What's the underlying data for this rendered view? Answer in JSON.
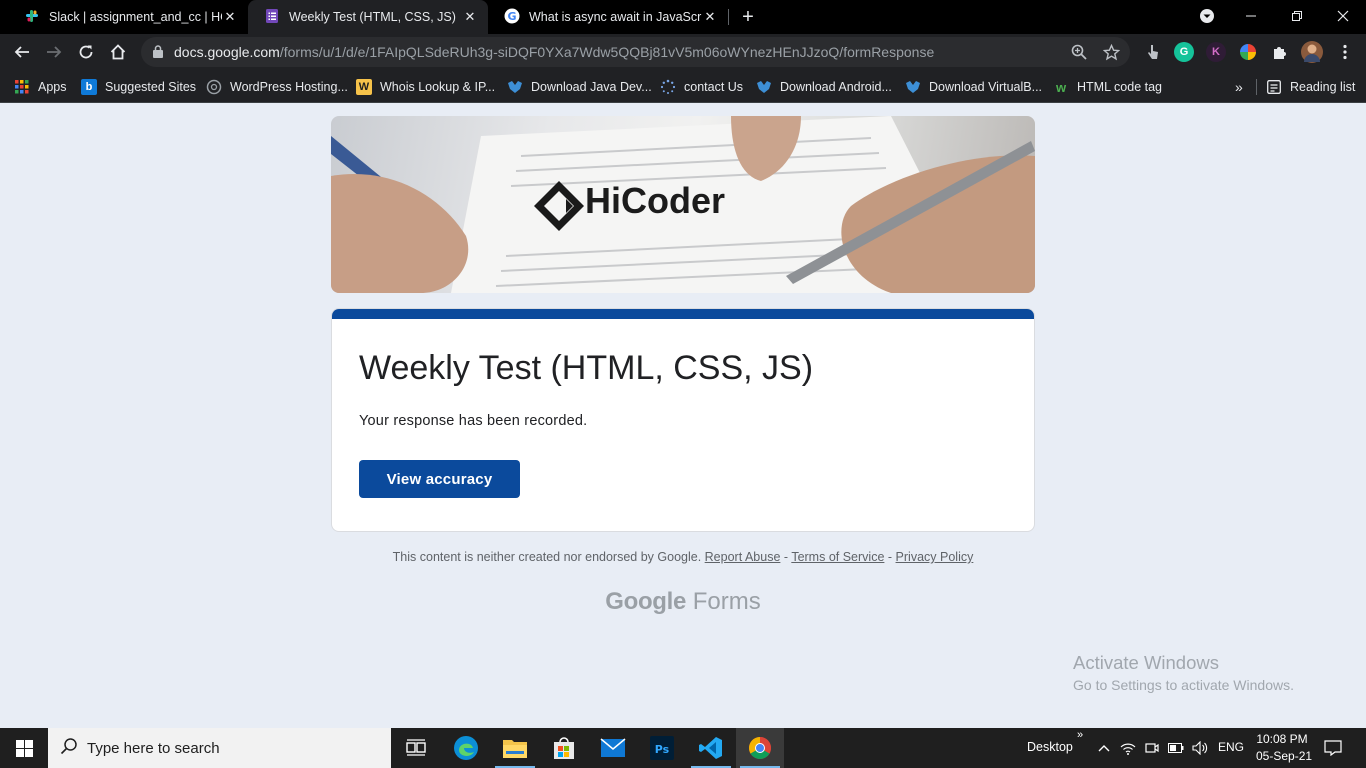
{
  "tabs": [
    {
      "title": "Slack | assignment_and_cc | HCM",
      "icon": "slack-icon"
    },
    {
      "title": "Weekly Test (HTML, CSS, JS)",
      "icon": "google-forms-icon",
      "active": true
    },
    {
      "title": "What is async await in JavaScript",
      "icon": "google-icon"
    }
  ],
  "address_bar": {
    "host": "docs.google.com",
    "path": "/forms/u/1/d/e/1FAIpQLSdeRUh3g-siDQF0YXa7Wdw5QQBj81vV5m06oWYnezHEnJJzoQ/formResponse"
  },
  "bookmarks": {
    "items": [
      {
        "label": "Apps",
        "icon": "apps-grid-icon"
      },
      {
        "label": "Suggested Sites",
        "icon": "bing-icon"
      },
      {
        "label": "WordPress Hosting...",
        "icon": "wordpress-hosting-icon"
      },
      {
        "label": "Whois Lookup & IP...",
        "icon": "whois-icon"
      },
      {
        "label": "Download Java Dev...",
        "icon": "filehorse-icon"
      },
      {
        "label": "contact Us",
        "icon": "loading-dots-icon"
      },
      {
        "label": "Download Android...",
        "icon": "filehorse-icon"
      },
      {
        "label": "Download VirtualB...",
        "icon": "filehorse-icon"
      },
      {
        "label": "HTML code tag",
        "icon": "w3-icon"
      }
    ],
    "overflow": "»",
    "reading_list": "Reading list"
  },
  "banner": {
    "brand": "HiCoder"
  },
  "form": {
    "title": "Weekly Test (HTML, CSS, JS)",
    "message": "Your response has been recorded.",
    "button": "View accuracy",
    "accent_color": "#0b4a9c"
  },
  "footer": {
    "disclaimer": "This content is neither created nor endorsed by Google.",
    "report_abuse": "Report Abuse",
    "sep": "-",
    "terms": "Terms of Service",
    "privacy": "Privacy Policy",
    "logo_google": "Google",
    "logo_forms": "Forms"
  },
  "watermark": {
    "line1": "Activate Windows",
    "line2": "Go to Settings to activate Windows."
  },
  "taskbar": {
    "search_placeholder": "Type here to search",
    "apps": [
      "task-view-icon",
      "edge-icon",
      "file-explorer-icon",
      "store-icon",
      "mail-icon",
      "photoshop-icon",
      "vscode-icon",
      "chrome-icon"
    ],
    "desktop_label": "Desktop",
    "language": "ENG",
    "time": "10:08 PM",
    "date": "05-Sep-21"
  }
}
